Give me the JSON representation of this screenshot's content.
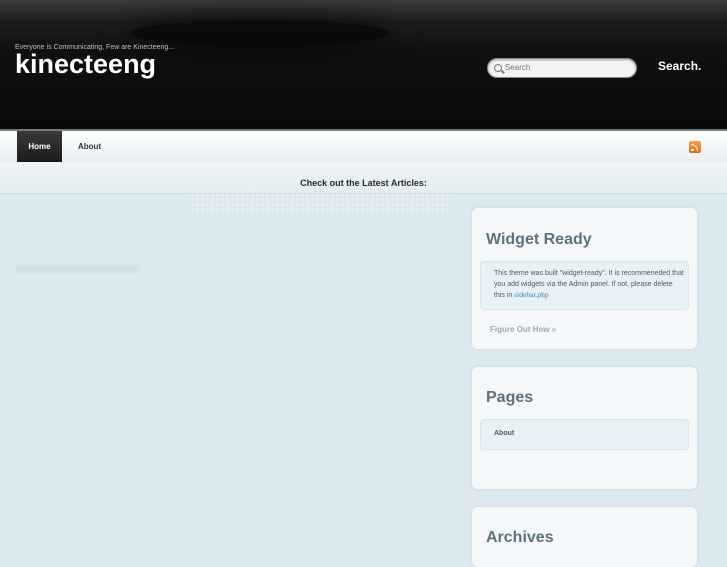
{
  "header": {
    "tagline": "Everyone is Communicating, Few are Kinecteeng...",
    "site_title": "kinecteeng",
    "search_placeholder": "Search",
    "search_button": "Search."
  },
  "nav": {
    "items": [
      {
        "label": "Home",
        "active": true
      },
      {
        "label": "About",
        "active": false
      }
    ],
    "rss_icon": "rss-icon"
  },
  "latest_bar": {
    "label": "Check out the Latest Articles:"
  },
  "sidebar": {
    "widget_ready": {
      "title": "Widget Ready",
      "text_before_link": "This theme was built \"widget-ready\". It is recommeneded that you add widgets via the Admin panel. If not, please delete this in ",
      "link_text": "sidebar.php",
      "more_link": "Figure Out How »"
    },
    "pages": {
      "title": "Pages",
      "items": [
        "About"
      ]
    },
    "archives": {
      "title": "Archives"
    }
  },
  "colors": {
    "header_bg": "#0f0f0f",
    "page_bg": "#dde9f0",
    "widget_title": "#5e717e",
    "link": "#3c83b7",
    "rss": "#f08a24"
  }
}
